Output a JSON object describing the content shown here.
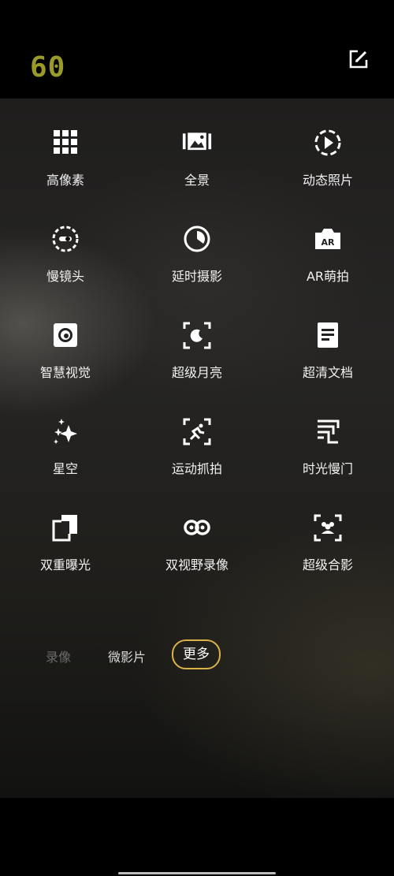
{
  "top_bar": {
    "fps_label": "60",
    "edit_icon": "edit-icon"
  },
  "modes": [
    {
      "label": "高像素",
      "icon": "high-pixel-icon"
    },
    {
      "label": "全景",
      "icon": "panorama-icon"
    },
    {
      "label": "动态照片",
      "icon": "live-photo-icon"
    },
    {
      "label": "慢镜头",
      "icon": "slow-motion-icon"
    },
    {
      "label": "延时摄影",
      "icon": "timelapse-icon"
    },
    {
      "label": "AR萌拍",
      "icon": "ar-camera-icon"
    },
    {
      "label": "智慧视觉",
      "icon": "smart-vision-icon"
    },
    {
      "label": "超级月亮",
      "icon": "super-moon-icon"
    },
    {
      "label": "超清文档",
      "icon": "document-icon"
    },
    {
      "label": "星空",
      "icon": "starry-sky-icon"
    },
    {
      "label": "运动抓拍",
      "icon": "sports-capture-icon"
    },
    {
      "label": "时光慢门",
      "icon": "slow-shutter-icon"
    },
    {
      "label": "双重曝光",
      "icon": "double-exposure-icon"
    },
    {
      "label": "双视野录像",
      "icon": "dual-view-video-icon"
    },
    {
      "label": "超级合影",
      "icon": "group-photo-icon"
    }
  ],
  "mode_tabs": [
    {
      "label": "录像",
      "state": "dim"
    },
    {
      "label": "微影片",
      "state": "normal"
    },
    {
      "label": "更多",
      "state": "active"
    }
  ],
  "colors": {
    "accent": "#d9b24a",
    "fps": "#9a9a2a",
    "background": "#000000"
  }
}
